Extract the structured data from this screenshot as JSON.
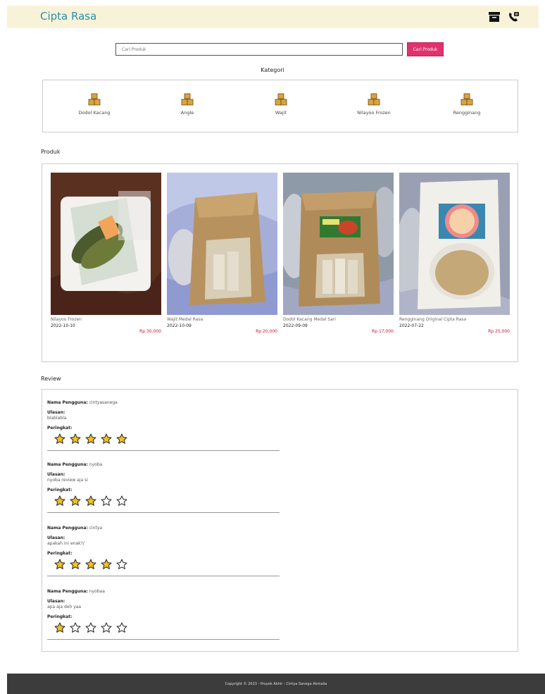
{
  "navbar": {
    "brand": "Cipta Rasa",
    "icons": [
      "archive-icon",
      "phone-icon"
    ]
  },
  "search": {
    "placeholder": "Cari Produk",
    "button_label": "Cari Produk"
  },
  "kategori": {
    "title": "Kategori",
    "items": [
      {
        "label": "Dodol Kacang",
        "icon": "boxes-icon"
      },
      {
        "label": "Angle",
        "icon": "boxes-icon"
      },
      {
        "label": "Wajit",
        "icon": "boxes-icon"
      },
      {
        "label": "Nilayoo Frozen",
        "icon": "boxes-icon"
      },
      {
        "label": "Rengginang",
        "icon": "boxes-icon"
      }
    ]
  },
  "produk": {
    "title": "Produk",
    "items": [
      {
        "name": "Nilayoo Frozen",
        "date": "2022-10-10",
        "price": "Rp 30,000"
      },
      {
        "name": "Wajit Medal Rasa",
        "date": "2022-10-09",
        "price": "Rp 20,000"
      },
      {
        "name": "Dodol Kacang Medal Sari",
        "date": "2022-09-09",
        "price": "Rp 17,000"
      },
      {
        "name": "Rengginang Original Cipta Rasa",
        "date": "2022-07-22",
        "price": "Rp 25,000"
      }
    ]
  },
  "review": {
    "title": "Review",
    "user_label": "Nama Pengguna:",
    "ulasan_label": "Ulasan:",
    "peringkat_label": "Peringkat:",
    "items": [
      {
        "user": "cintyasanega",
        "text": "blablabla",
        "rating": 5
      },
      {
        "user": "nyoba",
        "text": "nyoba review aja si",
        "rating": 3
      },
      {
        "user": "cintya",
        "text": "apakah ini enak?/",
        "rating": 4
      },
      {
        "user": "nyobaa",
        "text": "apa aja deh yaa",
        "rating": 1
      }
    ]
  },
  "footer": {
    "text": "Copyright © 2023 - Proyek Akhir - Cintya Sanega Akmalia"
  },
  "colors": {
    "brand": "#2a8fb0",
    "accent": "#e0336d",
    "price": "#d0142c",
    "star": "#f4c020"
  }
}
